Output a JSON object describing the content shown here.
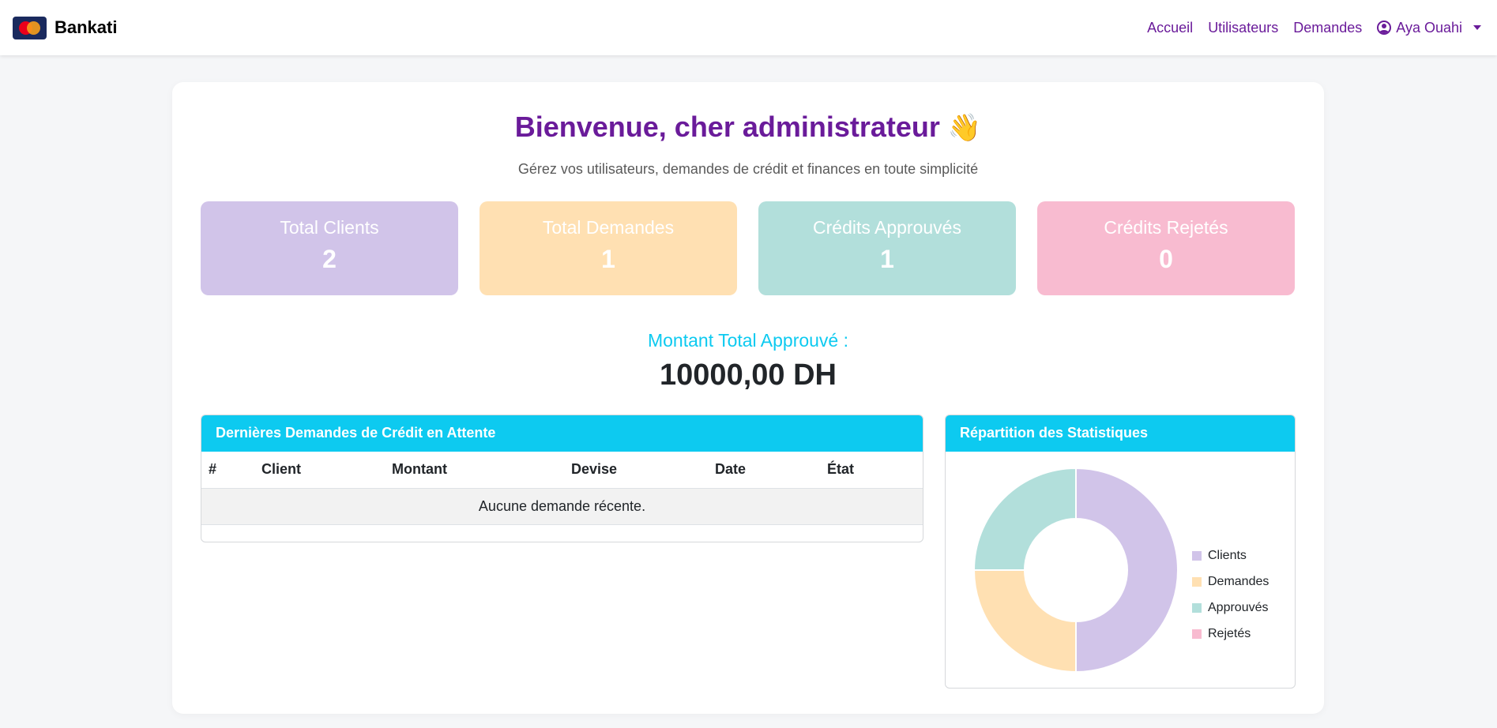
{
  "app": {
    "brand": "Bankati"
  },
  "nav": {
    "links": [
      "Accueil",
      "Utilisateurs",
      "Demandes"
    ],
    "user": "Aya Ouahi"
  },
  "hero": {
    "title": "Bienvenue, cher administrateur",
    "emoji": "👋",
    "subtitle": "Gérez vos utilisateurs, demandes de crédit et finances en toute simplicité"
  },
  "stats": [
    {
      "label": "Total Clients",
      "value": "2",
      "color": "#d1c4e9"
    },
    {
      "label": "Total Demandes",
      "value": "1",
      "color": "#ffe0b2"
    },
    {
      "label": "Crédits Approuvés",
      "value": "1",
      "color": "#b2dfdb"
    },
    {
      "label": "Crédits Rejetés",
      "value": "0",
      "color": "#f8bbd0"
    }
  ],
  "total": {
    "label": "Montant Total Approuvé :",
    "value": "10000,00 DH"
  },
  "requests": {
    "title": "Dernières Demandes de Crédit en Attente",
    "columns": [
      "#",
      "Client",
      "Montant",
      "Devise",
      "Date",
      "État"
    ],
    "empty_text": "Aucune demande récente."
  },
  "chart_panel": {
    "title": "Répartition des Statistiques"
  },
  "chart_data": {
    "type": "pie",
    "categories": [
      "Clients",
      "Demandes",
      "Approuvés",
      "Rejetés"
    ],
    "values": [
      2,
      1,
      1,
      0
    ],
    "colors": [
      "#d1c4e9",
      "#ffe0b2",
      "#b2dfdb",
      "#f8bbd0"
    ],
    "legend": "right"
  }
}
